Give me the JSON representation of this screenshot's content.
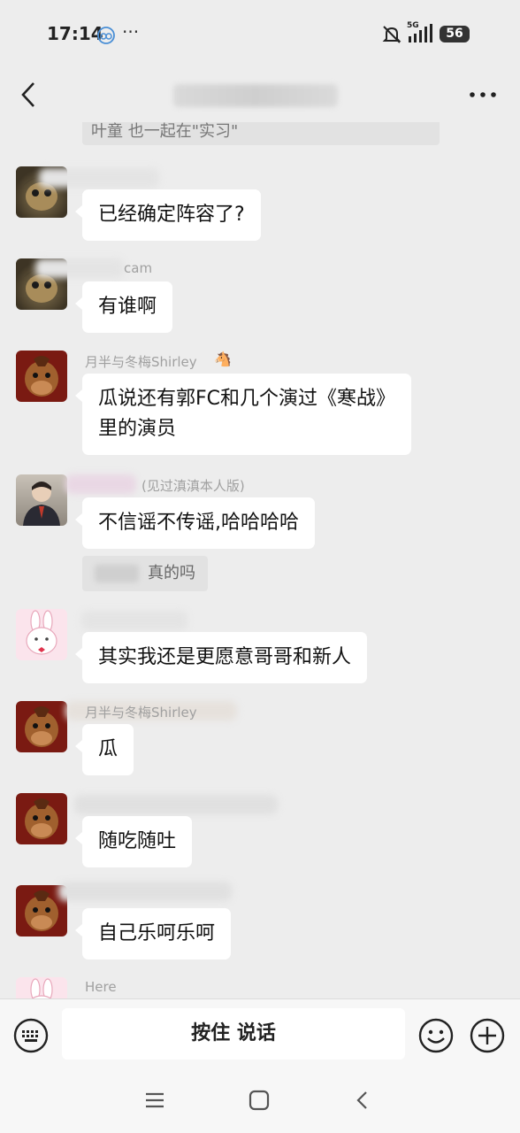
{
  "status_bar": {
    "time": "17:14",
    "dots": "···",
    "network": "5G",
    "battery": "56"
  },
  "chat": {
    "system_snippet": "叶童 也一起在\"实习\"",
    "messages": [
      {
        "sender": "",
        "text": "已经确定阵容了?"
      },
      {
        "sender": "cam",
        "text": "有谁啊"
      },
      {
        "sender": "月半与冬梅Shirley",
        "text_line1": "瓜说还有郭FC和几个演过《寒战》",
        "text_line2": "里的演员"
      },
      {
        "sender": "(见过滇滇本人版)",
        "text": "不信谣不传谣,哈哈哈哈",
        "quote": "真的吗"
      },
      {
        "sender": "",
        "text": "其实我还是更愿意哥哥和新人"
      },
      {
        "sender": "月半与冬梅Shirley",
        "text": "瓜"
      },
      {
        "sender": "",
        "text": "随吃随吐"
      },
      {
        "sender": "",
        "text": "自己乐呵乐呵"
      },
      {
        "sender": "Here",
        "text": ""
      }
    ]
  },
  "input_bar": {
    "hold_to_talk": "按住 说话"
  },
  "icons": {
    "back": "back-arrow-icon",
    "more": "more-dots-icon",
    "keyboard": "keyboard-icon",
    "emoji": "emoji-icon",
    "plus": "plus-icon",
    "menu": "menu-icon",
    "home": "home-icon",
    "nav_back": "nav-back-icon"
  },
  "colors": {
    "background": "#ededed",
    "bubble": "#ffffff",
    "bar": "#f7f7f7"
  }
}
